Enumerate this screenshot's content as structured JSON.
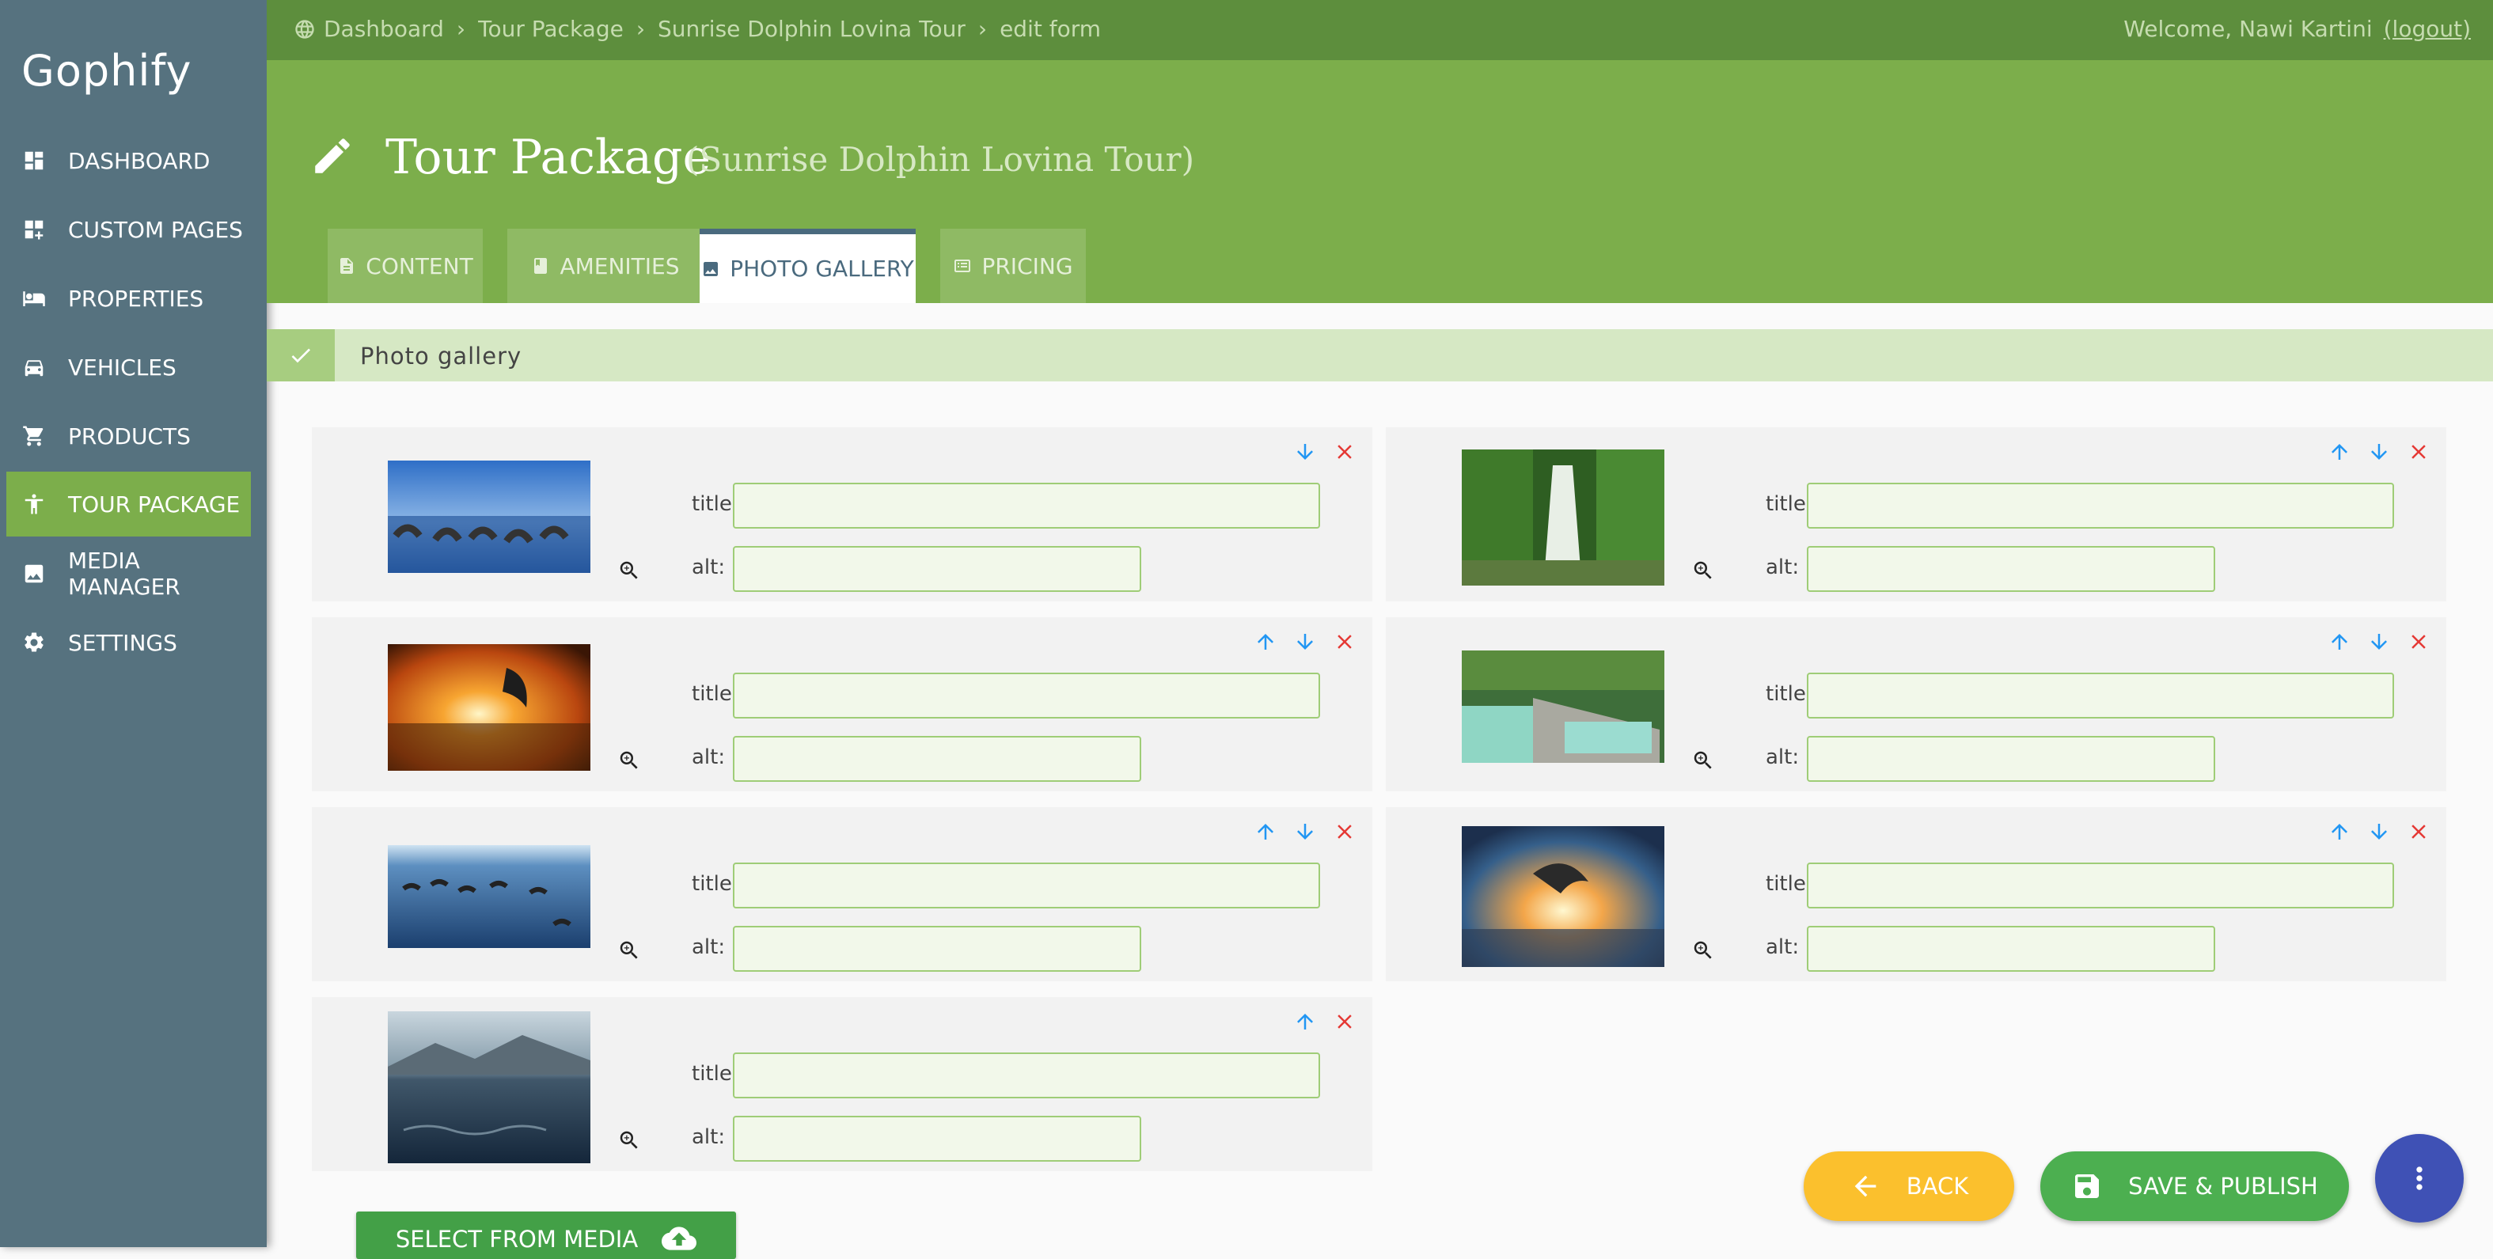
{
  "app": {
    "name": "Gophify"
  },
  "sidebar": {
    "items": [
      {
        "label": "DASHBOARD",
        "icon": "dashboard-icon"
      },
      {
        "label": "CUSTOM PAGES",
        "icon": "custom-pages-icon"
      },
      {
        "label": "PROPERTIES",
        "icon": "bed-icon"
      },
      {
        "label": "VEHICLES",
        "icon": "car-icon"
      },
      {
        "label": "PRODUCTS",
        "icon": "cart-icon"
      },
      {
        "label": "TOUR PACKAGE",
        "icon": "person-icon",
        "active": true
      },
      {
        "label": "MEDIA MANAGER",
        "icon": "image-icon"
      },
      {
        "label": "SETTINGS",
        "icon": "gear-icon"
      }
    ]
  },
  "topbar": {
    "breadcrumb": [
      "Dashboard",
      "Tour Package",
      "Sunrise Dolphin Lovina Tour",
      "edit form"
    ],
    "welcome": "Welcome, Nawi Kartini",
    "logout": "(logout)"
  },
  "header": {
    "title": "Tour Package",
    "subtitle": "(Sunrise Dolphin Lovina Tour)"
  },
  "tabs": [
    {
      "label": "CONTENT",
      "icon": "document-icon"
    },
    {
      "label": "AMENITIES",
      "icon": "book-icon"
    },
    {
      "label": "PHOTO GALLERY",
      "icon": "image-icon",
      "active": true
    },
    {
      "label": "PRICING",
      "icon": "pricing-icon"
    }
  ],
  "section": {
    "label": "Photo gallery"
  },
  "gallery": {
    "title_label": "title:",
    "alt_label": "alt:",
    "items": [
      {
        "title": "",
        "alt": "",
        "scene": "dolphins-blue-sky"
      },
      {
        "title": "",
        "alt": "",
        "scene": "waterfall"
      },
      {
        "title": "",
        "alt": "",
        "scene": "dolphin-sunset"
      },
      {
        "title": "",
        "alt": "",
        "scene": "hot-spring-pools"
      },
      {
        "title": "",
        "alt": "",
        "scene": "dolphins-sea"
      },
      {
        "title": "",
        "alt": "",
        "scene": "dolphin-jump-sunset"
      },
      {
        "title": "",
        "alt": "",
        "scene": "sea-mountains"
      }
    ]
  },
  "actions": {
    "back": "BACK",
    "save": "SAVE & PUBLISH",
    "select_media": "SELECT FROM MEDIA"
  },
  "colors": {
    "sidebar": "#56727f",
    "accent": "#7cae4b",
    "topbar": "#5d8e3d",
    "back_button": "#fbc02d",
    "save_button": "#4caf50",
    "fab": "#3f51b5",
    "move_arrow": "#2196f3",
    "delete": "#e53935"
  }
}
